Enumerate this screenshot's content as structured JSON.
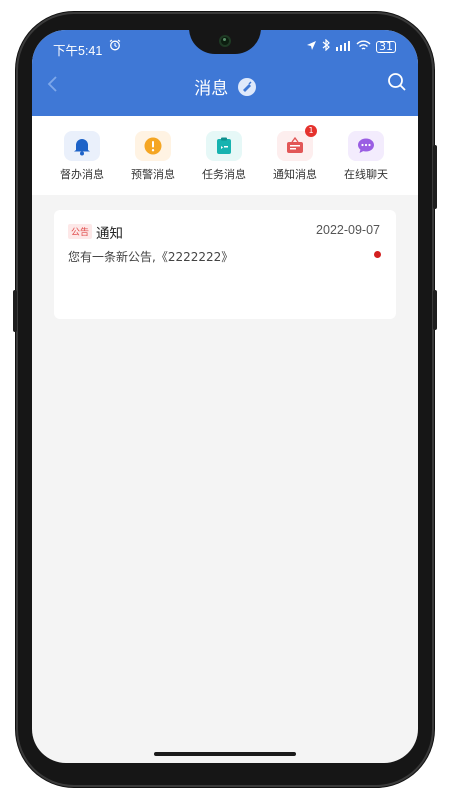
{
  "status_bar": {
    "time": "下午5:41",
    "battery": "31"
  },
  "nav": {
    "title": "消息"
  },
  "categories": [
    {
      "label": "督办消息",
      "icon": "bell-icon",
      "color": "#1e63c8",
      "bg": "#eaf0fb"
    },
    {
      "label": "预警消息",
      "icon": "warning-icon",
      "color": "#f5a623",
      "bg": "#fff3e3"
    },
    {
      "label": "任务消息",
      "icon": "clipboard-icon",
      "color": "#17b3b0",
      "bg": "#e6f8f7"
    },
    {
      "label": "通知消息",
      "icon": "notice-board-icon",
      "color": "#e25656",
      "bg": "#fdeeee",
      "badge": "1"
    },
    {
      "label": "在线聊天",
      "icon": "chat-bubble-icon",
      "color": "#9a5ee3",
      "bg": "#f3ecfd"
    }
  ],
  "messages": [
    {
      "tag": "公告",
      "title": "通知",
      "date": "2022-09-07",
      "body": "您有一条新公告,《2222222》",
      "unread": true
    }
  ]
}
